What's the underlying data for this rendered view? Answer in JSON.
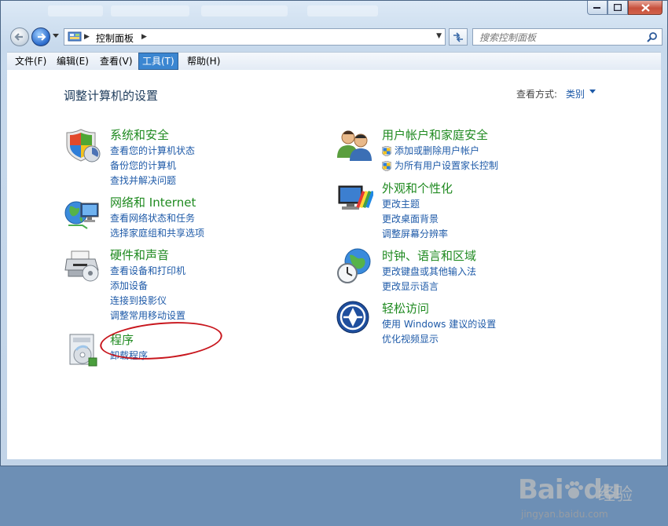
{
  "window": {
    "colors": {
      "frame": "#c7d9ec",
      "close_button": "#c7503c",
      "link": "#1e5aa8",
      "category_title": "#1f8a20",
      "menu_active": "#3b86d1",
      "annotation": "#c8161d"
    }
  },
  "address_bar": {
    "icon": "control-panel-icon",
    "path": "控制面板",
    "search_placeholder": "搜索控制面板"
  },
  "menu": {
    "items": [
      "文件(F)",
      "编辑(E)",
      "查看(V)",
      "工具(T)",
      "帮助(H)"
    ],
    "active_index": 3
  },
  "content": {
    "title": "调整计算机的设置",
    "view_by_label": "查看方式:",
    "view_by_value": "类别"
  },
  "categories": [
    {
      "icon": "system-security-icon",
      "title": "系统和安全",
      "links": [
        "查看您的计算机状态",
        "备份您的计算机",
        "查找并解决问题"
      ]
    },
    {
      "icon": "network-internet-icon",
      "title": "网络和 Internet",
      "links": [
        "查看网络状态和任务",
        "选择家庭组和共享选项"
      ]
    },
    {
      "icon": "hardware-sound-icon",
      "title": "硬件和声音",
      "links": [
        "查看设备和打印机",
        "添加设备",
        "连接到投影仪",
        "调整常用移动设置"
      ]
    },
    {
      "icon": "programs-icon",
      "title": "程序",
      "links": [
        "卸载程序"
      ]
    },
    {
      "icon": "user-accounts-icon",
      "title": "用户帐户和家庭安全",
      "links": [
        "添加或删除用户帐户",
        "为所有用户设置家长控制"
      ]
    },
    {
      "icon": "appearance-icon",
      "title": "外观和个性化",
      "links": [
        "更改主题",
        "更改桌面背景",
        "调整屏幕分辨率"
      ]
    },
    {
      "icon": "clock-language-region-icon",
      "title": "时钟、语言和区域",
      "links": [
        "更改键盘或其他输入法",
        "更改显示语言"
      ]
    },
    {
      "icon": "ease-of-access-icon",
      "title": "轻松访问",
      "links": [
        "使用 Windows 建议的设置",
        "优化视频显示"
      ]
    }
  ],
  "watermark": {
    "brand": "Bai",
    "brand_suffix": "du",
    "cn": "经验",
    "url": "jingyan.baidu.com"
  }
}
